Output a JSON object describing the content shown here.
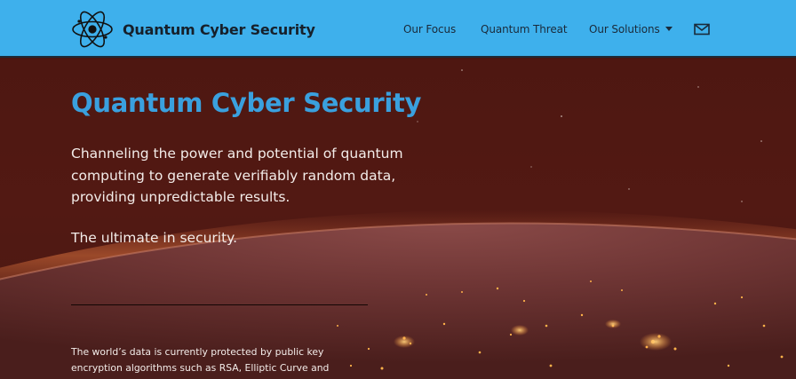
{
  "brand": {
    "name": "Quantum Cyber Security",
    "logo_icon": "atom-icon"
  },
  "nav": {
    "items": [
      {
        "label": "Our Focus"
      },
      {
        "label": "Quantum Threat"
      },
      {
        "label": "Our Solutions",
        "has_dropdown": true,
        "dropdown_icon": "caret-down-icon"
      }
    ],
    "contact_icon": "mail-icon"
  },
  "hero": {
    "title": "Quantum Cyber Security",
    "lead": "Channeling the power and potential of quantum computing to generate verifiably random data, providing unpredictable results.",
    "tagline": "The ultimate in security.",
    "body": "The world’s data is currently protected by public key encryption algorithms such as RSA, Elliptic Curve and"
  },
  "colors": {
    "navbar_bg": "#3eb0ec",
    "nav_text": "#1a2a3a",
    "hero_bg": "#4e1711",
    "title_accent": "#3aa0de",
    "hero_text": "#f3ece9"
  }
}
